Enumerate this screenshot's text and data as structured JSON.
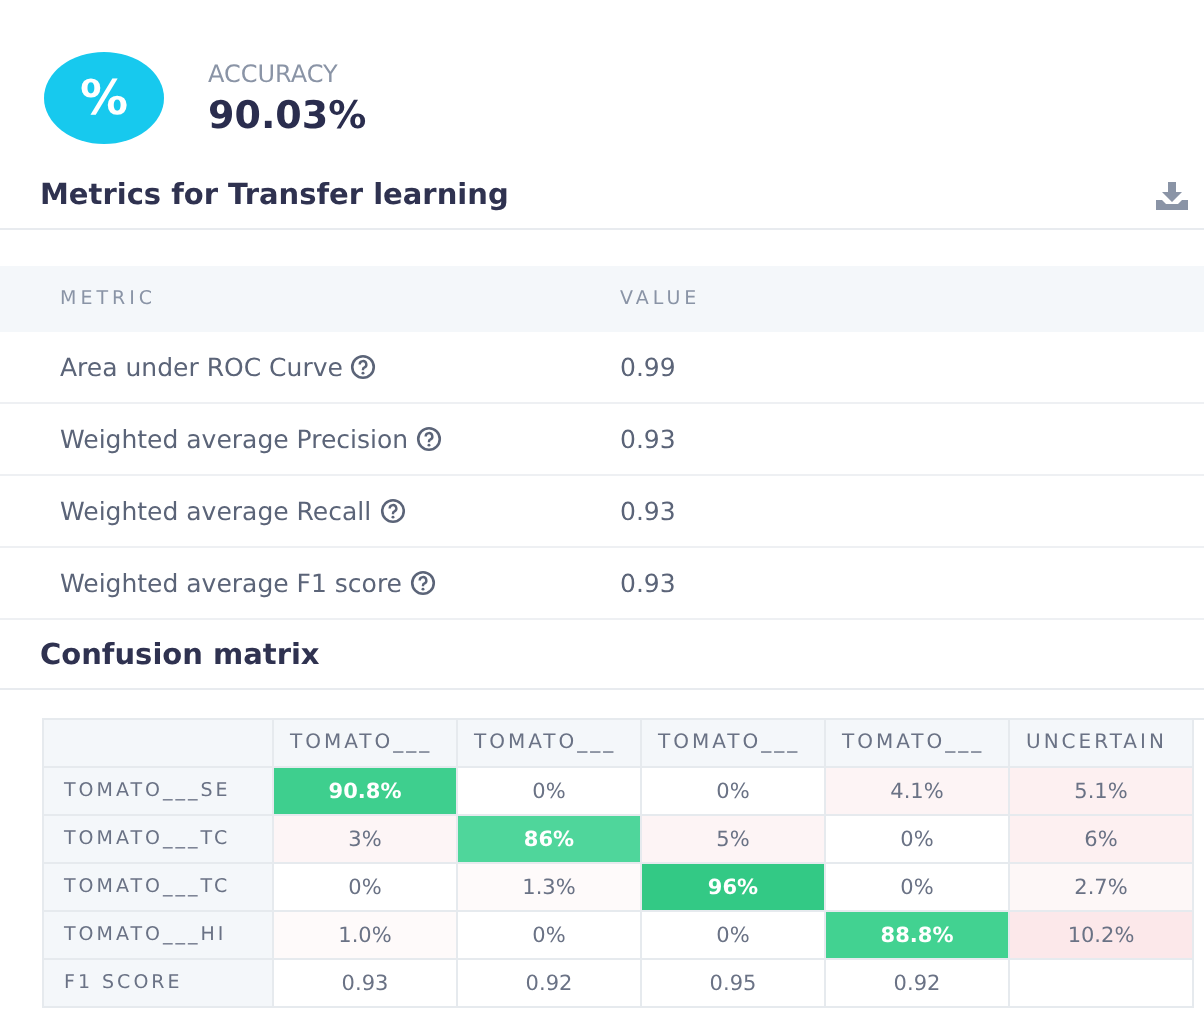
{
  "accuracy": {
    "label": "ACCURACY",
    "value": "90.03%",
    "icon": "%"
  },
  "metrics": {
    "title": "Metrics for Transfer learning",
    "columns": [
      "METRIC",
      "VALUE"
    ],
    "rows": [
      {
        "name": "Area under ROC Curve",
        "value": "0.99"
      },
      {
        "name": "Weighted average Precision",
        "value": "0.93"
      },
      {
        "name": "Weighted average Recall",
        "value": "0.93"
      },
      {
        "name": "Weighted average F1 score",
        "value": "0.93"
      }
    ]
  },
  "confusion": {
    "title": "Confusion matrix",
    "columns": [
      "TOMATO___",
      "TOMATO___",
      "TOMATO___",
      "TOMATO___",
      "UNCERTAIN"
    ],
    "rows": [
      {
        "label": "TOMATO___SE",
        "cells": [
          {
            "text": "90.8%",
            "color": "#3ecf8e"
          },
          {
            "text": "0%"
          },
          {
            "text": "0%"
          },
          {
            "text": "4.1%",
            "color": "#fdf4f5"
          },
          {
            "text": "5.1%",
            "color": "#fdf0f1"
          }
        ]
      },
      {
        "label": "TOMATO___TC",
        "cells": [
          {
            "text": "3%",
            "color": "#fdf5f6"
          },
          {
            "text": "86%",
            "color": "#4fd69b"
          },
          {
            "text": "5%",
            "color": "#fdf4f5"
          },
          {
            "text": "0%"
          },
          {
            "text": "6%",
            "color": "#fdf0f1"
          }
        ]
      },
      {
        "label": "TOMATO___TC",
        "cells": [
          {
            "text": "0%"
          },
          {
            "text": "1.3%",
            "color": "#fefafa"
          },
          {
            "text": "96%",
            "color": "#33c985"
          },
          {
            "text": "0%"
          },
          {
            "text": "2.7%",
            "color": "#fdf7f7"
          }
        ]
      },
      {
        "label": "TOMATO___HI",
        "cells": [
          {
            "text": "1.0%",
            "color": "#fefafa"
          },
          {
            "text": "0%"
          },
          {
            "text": "0%"
          },
          {
            "text": "88.8%",
            "color": "#42d291"
          },
          {
            "text": "10.2%",
            "color": "#fce8ea"
          }
        ]
      },
      {
        "label": "F1 SCORE",
        "cells": [
          {
            "text": "0.93"
          },
          {
            "text": "0.92"
          },
          {
            "text": "0.95"
          },
          {
            "text": "0.92"
          }
        ]
      }
    ]
  }
}
